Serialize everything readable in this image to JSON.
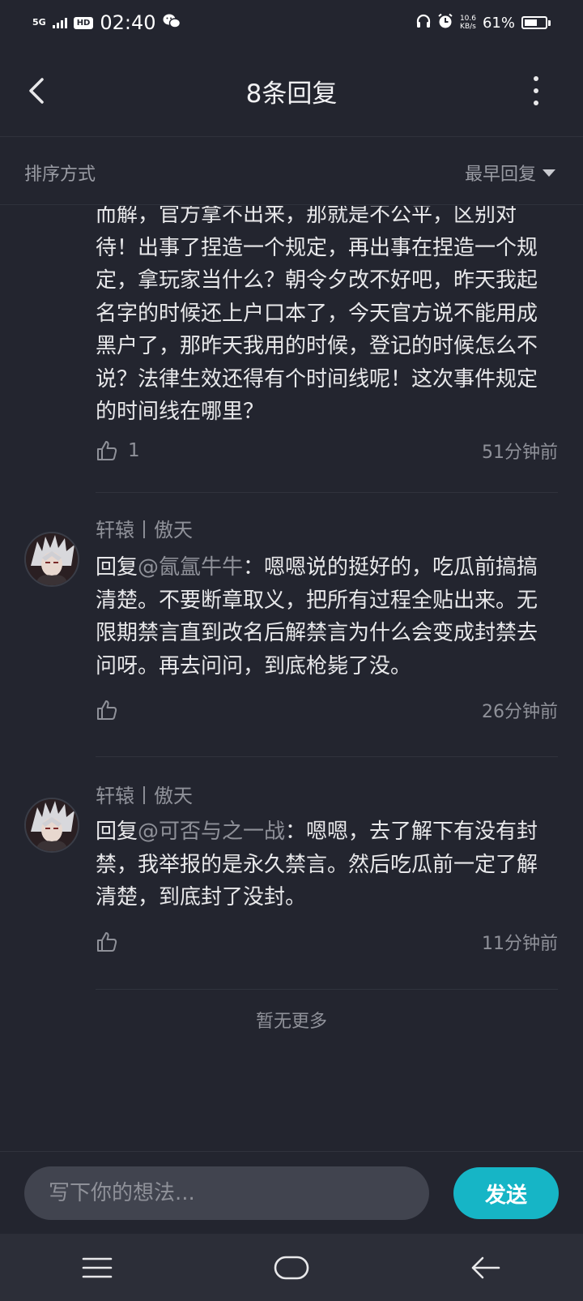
{
  "status_bar": {
    "network": "5G",
    "hd": "HD",
    "time": "02:40",
    "speed_value": "10.6",
    "speed_unit": "KB/s",
    "battery": "61%",
    "battery_level": 0.61,
    "icons": [
      "signal-icon",
      "wechat-icon",
      "headphones-icon",
      "alarm-icon",
      "battery-icon"
    ]
  },
  "header": {
    "title": "8条回复"
  },
  "sort": {
    "label": "排序方式",
    "selected": "最早回复"
  },
  "comments": [
    {
      "text": "而解，官方拿不出来，那就是不公平，区别对待！出事了捏造一个规定，再出事在捏造一个规定，拿玩家当什么？朝令夕改不好吧，昨天我起名字的时候还上户口本了，今天官方说不能用成黑户了，那昨天我用的时候，登记的时候怎么不说？法律生效还得有个时间线呢！这次事件规定的时间线在哪里？",
      "likes": "1",
      "time": "51分钟前"
    },
    {
      "username": "轩辕丨傲天",
      "reply_prefix": "回复",
      "reply_to": "@氤氲牛牛",
      "text": "：嗯嗯说的挺好的，吃瓜前搞搞清楚。不要断章取义，把所有过程全贴出来。无限期禁言直到改名后解禁言为什么会变成封禁去问呀。再去问问，到底枪毙了没。",
      "time": "26分钟前"
    },
    {
      "username": "轩辕丨傲天",
      "reply_prefix": "回复",
      "reply_to": "@可否与之一战",
      "text": "：嗯嗯，去了解下有没有封禁，我举报的是永久禁言。然后吃瓜前一定了解清楚，到底封了没封。",
      "time": "11分钟前"
    }
  ],
  "no_more": "暂无更多",
  "input": {
    "placeholder": "写下你的想法...",
    "send_label": "发送"
  },
  "colors": {
    "background": "#23252f",
    "accent": "#16b5c6",
    "muted_text": "#8f9199"
  }
}
